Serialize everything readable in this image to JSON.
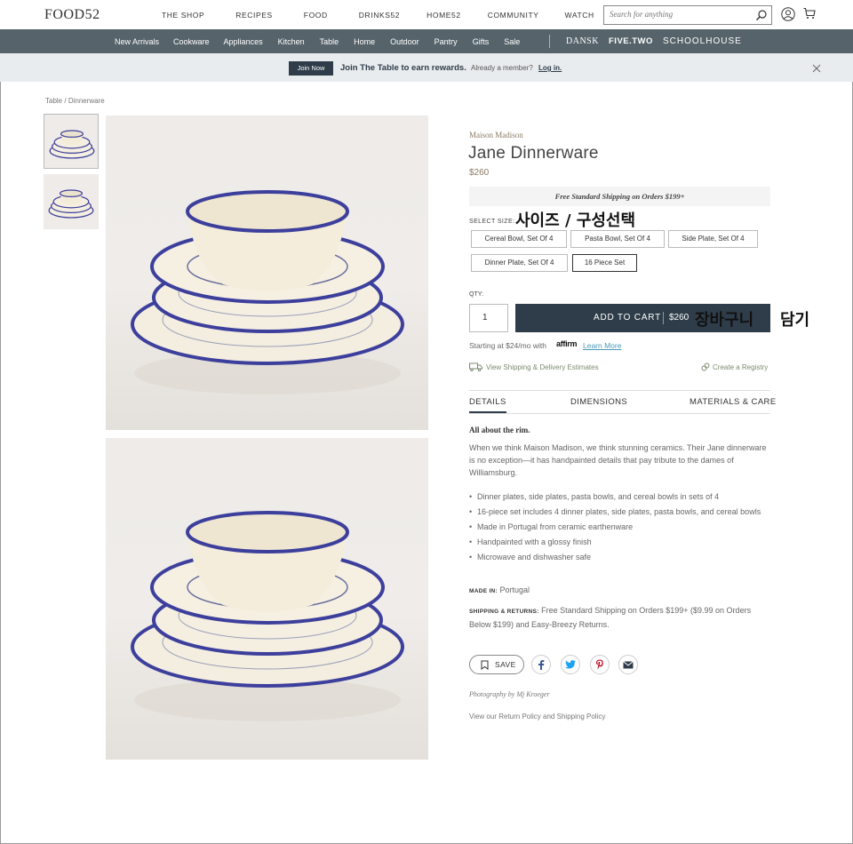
{
  "header": {
    "logo": "FOOD52",
    "nav": [
      "THE SHOP",
      "RECIPES",
      "FOOD",
      "DRINKS52",
      "HOME52",
      "COMMUNITY",
      "WATCH"
    ],
    "search_placeholder": "Search for anything"
  },
  "subnav": {
    "items": [
      "New Arrivals",
      "Cookware",
      "Appliances",
      "Kitchen",
      "Table",
      "Home",
      "Outdoor",
      "Pantry",
      "Gifts",
      "Sale"
    ],
    "brands": [
      "DANSK",
      "FIVE.TWO",
      "SCHOOLHOUSE"
    ]
  },
  "promo": {
    "join_label": "Join Now",
    "text": "Join The Table to earn rewards.",
    "member_text": "Already a member?",
    "login_label": "Log in."
  },
  "breadcrumb": [
    "Table",
    "Dinnerware"
  ],
  "product": {
    "maker": "Maison Madison",
    "title": "Jane Dinnerware",
    "price": "$260",
    "shipping_banner": "Free Standard Shipping on Orders $199+",
    "select_size_label": "SELECT SIZE:",
    "sizes": [
      "Cereal Bowl, Set Of 4",
      "Pasta Bowl, Set Of 4",
      "Side Plate, Set Of 4",
      "Dinner Plate, Set Of 4",
      "16 Piece Set"
    ],
    "selected_size": "16 Piece Set",
    "qty_label": "QTY:",
    "qty_value": "1",
    "add_to_cart_label": "ADD TO CART",
    "add_to_cart_price": "$260",
    "affirm_text": "Starting at $24/mo with",
    "affirm_logo": "affirm",
    "learn_more": "Learn More",
    "shipping_link": "View Shipping & Delivery Estimates",
    "registry_link": "Create a Registry"
  },
  "annotations": {
    "size_note": "사이즈 / 구성선택",
    "cart_note": "장바구니",
    "cart_note2": "담기"
  },
  "tabs": [
    "DETAILS",
    "DIMENSIONS",
    "MATERIALS & CARE"
  ],
  "details": {
    "heading": "All about the rim.",
    "paragraph": "When we think Maison Madison, we think stunning ceramics. Their Jane dinnerware is no exception—it has handpainted details that pay tribute to the dames of Williamsburg.",
    "bullets": [
      "Dinner plates, side plates, pasta bowls, and cereal bowls in sets of 4",
      "16-piece set includes 4 dinner plates, side plates, pasta bowls, and cereal bowls",
      "Made in Portugal from ceramic earthenware",
      "Handpainted with a glossy finish",
      "Microwave and dishwasher safe"
    ],
    "made_in_label": "MADE IN:",
    "made_in_value": "Portugal",
    "ship_label": "SHIPPING & RETURNS:",
    "ship_value": "Free Standard Shipping on Orders $199+ ($9.99 on Orders Below $199) and Easy-Breezy Returns."
  },
  "actions": {
    "save_label": "SAVE"
  },
  "footer_notes": {
    "photo_credit": "Photography by Mj Kroeger",
    "policy_prefix": "View our",
    "return_policy": "Return Policy",
    "and_text": "and",
    "shipping_policy": "Shipping Policy"
  },
  "colors": {
    "brand_dark": "#2e3d49",
    "subnav_bg": "#56636b",
    "promo_bg": "#e9ecee",
    "price_tan": "#8a7a66",
    "link_blue": "#4a9ab8",
    "plate_rim": "#3d3f9c"
  }
}
